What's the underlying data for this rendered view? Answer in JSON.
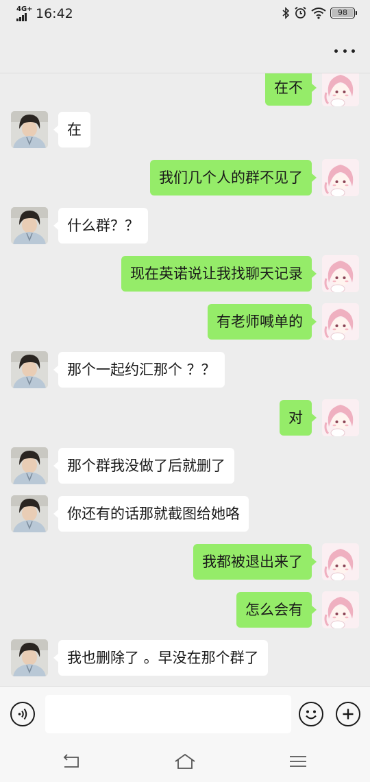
{
  "status_bar": {
    "network": "4G+",
    "time": "16:42",
    "battery": "98",
    "battery_level": 0.98,
    "icons": [
      "signal-icon",
      "bluetooth-icon",
      "alarm-icon",
      "wifi-icon",
      "battery-icon"
    ]
  },
  "title_bar": {
    "more_icon": "more-dots-icon"
  },
  "colors": {
    "background": "#ededed",
    "sent_bubble": "#95ec69",
    "received_bubble": "#ffffff",
    "input_bar": "#f7f7f7"
  },
  "messages": [
    {
      "side": "right",
      "text": "在不"
    },
    {
      "side": "left",
      "text": "在"
    },
    {
      "side": "right",
      "text": "我们几个人的群不见了"
    },
    {
      "side": "left",
      "text": "什么群？？"
    },
    {
      "side": "right",
      "text": "现在英诺说让我找聊天记录"
    },
    {
      "side": "right",
      "text": "有老师喊单的"
    },
    {
      "side": "left",
      "text": "那个一起约汇那个 ？？"
    },
    {
      "side": "right",
      "text": "对"
    },
    {
      "side": "left",
      "text": "那个群我没做了后就删了"
    },
    {
      "side": "left",
      "text": "你还有的话那就截图给她咯"
    },
    {
      "side": "right",
      "text": "我都被退出来了"
    },
    {
      "side": "right",
      "text": "怎么会有"
    },
    {
      "side": "left",
      "text": "我也删除了 。早没在那个群了"
    }
  ],
  "input_bar": {
    "value": "",
    "icons": [
      "voice-icon",
      "emoji-icon",
      "plus-icon"
    ]
  },
  "nav_bar": {
    "icons": [
      "back-icon",
      "home-icon",
      "menu-icon"
    ]
  }
}
